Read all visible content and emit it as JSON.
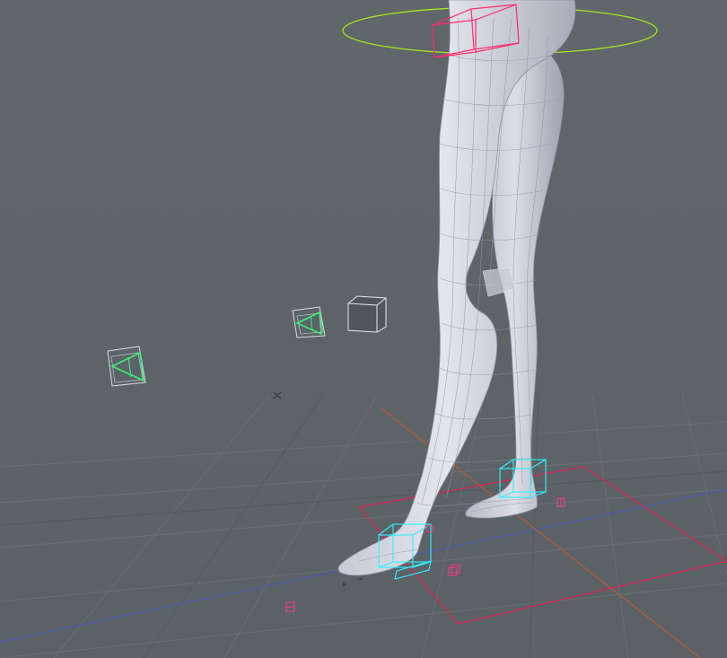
{
  "viewport": {
    "background_color": "#5e666a",
    "grid_color": "#6a7276",
    "grid_major_color": "#555c60",
    "x_axis_color": "#b8563c",
    "z_axis_color": "#4a5ba8",
    "selection_color": "#ff2a6d",
    "ik_control_color": "#2ff0ff",
    "hip_ring_color": "#a6e61a",
    "camera_icon_color": "#3cf07a",
    "mesh_color": "#d9dbe3",
    "wire_color": "#8e93a3"
  },
  "scene_items": [
    {
      "name": "character-legs-mesh",
      "icon": "mesh-figure"
    },
    {
      "name": "hip-control-ring",
      "icon": "ellipse-control"
    },
    {
      "name": "hip-box-control",
      "icon": "box-control"
    },
    {
      "name": "left-foot-ik-control",
      "icon": "cube-control"
    },
    {
      "name": "right-foot-ik-control",
      "icon": "cube-control"
    },
    {
      "name": "camera-1",
      "icon": "camera-icon"
    },
    {
      "name": "camera-2",
      "icon": "camera-icon"
    },
    {
      "name": "light-1",
      "icon": "cube-light-icon"
    },
    {
      "name": "knee-helper",
      "icon": "translucent-box"
    },
    {
      "name": "ground-selection-rect",
      "icon": "selection-rectangle"
    },
    {
      "name": "world-origin-marker",
      "icon": "crosshair-icon"
    }
  ]
}
